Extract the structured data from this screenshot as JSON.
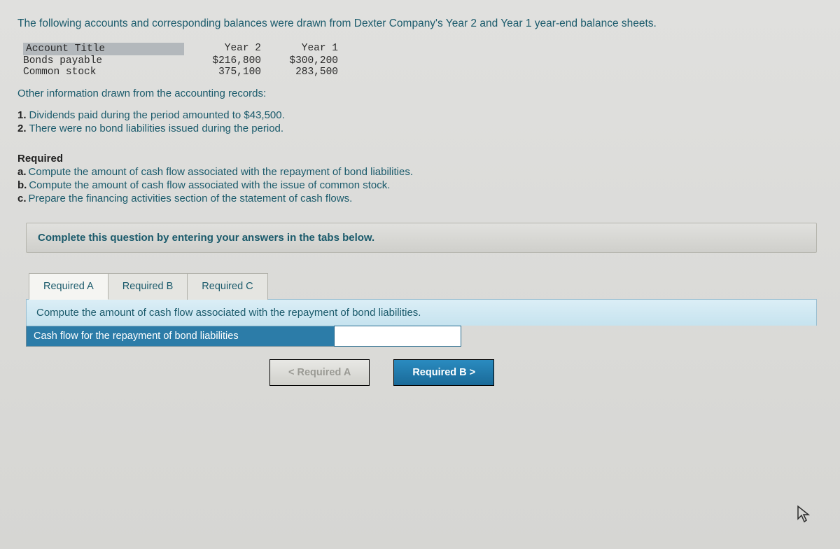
{
  "intro": "The following accounts and corresponding balances were drawn from Dexter Company's Year 2 and Year 1 year-end balance sheets.",
  "accountTable": {
    "headers": {
      "title": "Account Title",
      "y2": "Year 2",
      "y1": "Year 1"
    },
    "rows": [
      {
        "title": "Bonds payable",
        "y2": "$216,800",
        "y1": "$300,200"
      },
      {
        "title": "Common stock",
        "y2": "375,100",
        "y1": "283,500"
      }
    ]
  },
  "otherInfo": "Other information drawn from the accounting records:",
  "notes": [
    {
      "n": "1.",
      "text": "Dividends paid during the period amounted to $43,500."
    },
    {
      "n": "2.",
      "text": "There were no bond liabilities issued during the period."
    }
  ],
  "requiredTitle": "Required",
  "required": [
    {
      "n": "a.",
      "text": "Compute the amount of cash flow associated with the repayment of bond liabilities."
    },
    {
      "n": "b.",
      "text": "Compute the amount of cash flow associated with the issue of common stock."
    },
    {
      "n": "c.",
      "text": "Prepare the financing activities section of the statement of cash flows."
    }
  ],
  "completeBar": "Complete this question by entering your answers in the tabs below.",
  "tabs": {
    "a": "Required A",
    "b": "Required B",
    "c": "Required C"
  },
  "tabIntroA": "Compute the amount of cash flow associated with the repayment of bond liabilities.",
  "answerLabel": "Cash flow for the repayment of bond liabilities",
  "answerValue": "",
  "nav": {
    "prev": "<   Required A",
    "next": "Required B   >"
  }
}
